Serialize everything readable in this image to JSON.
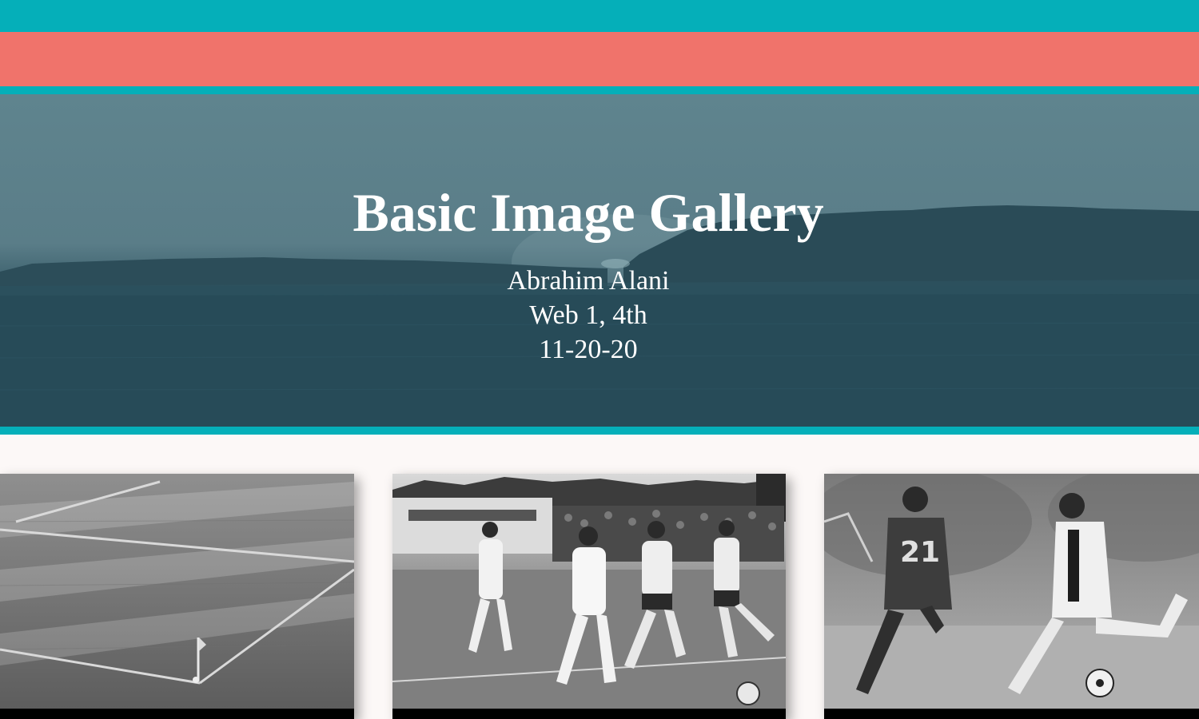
{
  "header": {
    "title": "Basic Image Gallery",
    "author": "Abrahim Alani",
    "class_period": "Web 1, 4th",
    "date": "11-20-20"
  },
  "theme": {
    "accent_teal": "#05afb9",
    "accent_coral": "#f0736b",
    "hero_tint": "#2f5461",
    "page_background": "#fcf8f7"
  },
  "gallery": {
    "images": [
      {
        "name": "corner-flag-field-photo"
      },
      {
        "name": "soccer-match-players-photo"
      },
      {
        "name": "soccer-kick-photo"
      }
    ]
  }
}
